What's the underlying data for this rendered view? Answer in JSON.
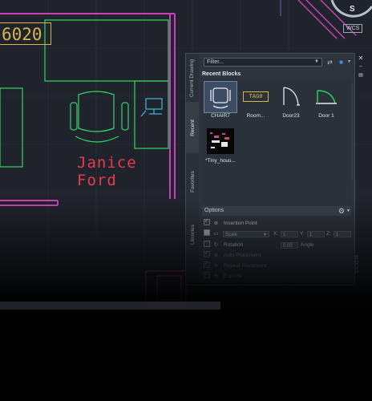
{
  "drawing": {
    "room_number": "6020",
    "occupant_line1": "Janice",
    "occupant_line2": "Ford",
    "compass_letter": "S",
    "wcs_label": "WCS"
  },
  "palette": {
    "tabs": [
      {
        "label": "Current Drawing"
      },
      {
        "label": "Recent"
      },
      {
        "label": "Favorites"
      },
      {
        "label": "Libraries"
      }
    ],
    "active_tab": "Recent",
    "filter_placeholder": "Filter...",
    "section_title": "Recent Blocks",
    "blocks": [
      {
        "label": "CHAIR7",
        "icon": "chair-block-icon",
        "selected": true
      },
      {
        "label": "Room...",
        "icon": "room-tag-block-icon",
        "tag_text": "TAG0"
      },
      {
        "label": "Door23",
        "icon": "door-block-icon"
      },
      {
        "label": "Door 1",
        "icon": "door-swing-block-icon"
      },
      {
        "label": "*Tiny_hous...",
        "icon": "tiny-house-block-icon"
      }
    ],
    "options_title": "Options",
    "options": {
      "insertion_point": "Insertion Point",
      "scale": "Scale",
      "x_label": "X:",
      "x_value": "1",
      "y_label": "Y:",
      "y_value": "1",
      "z_label": "Z:",
      "z_value": "1",
      "rotation": "Rotation",
      "angle_value": "0.00",
      "angle_label": "Angle",
      "auto_placement": "Auto-Placement",
      "repeat_placement": "Repeat Placement",
      "explode": "Explode"
    },
    "side_vertical_label": "BLOCKS"
  },
  "colors": {
    "wall_magenta": "#c940b8",
    "furniture_green": "#38d36a",
    "annotation_red": "#e53b4d",
    "tag_yellow": "#d8b44c",
    "computer_cyan": "#3fb7e0",
    "door_green": "#2fcf5a"
  }
}
